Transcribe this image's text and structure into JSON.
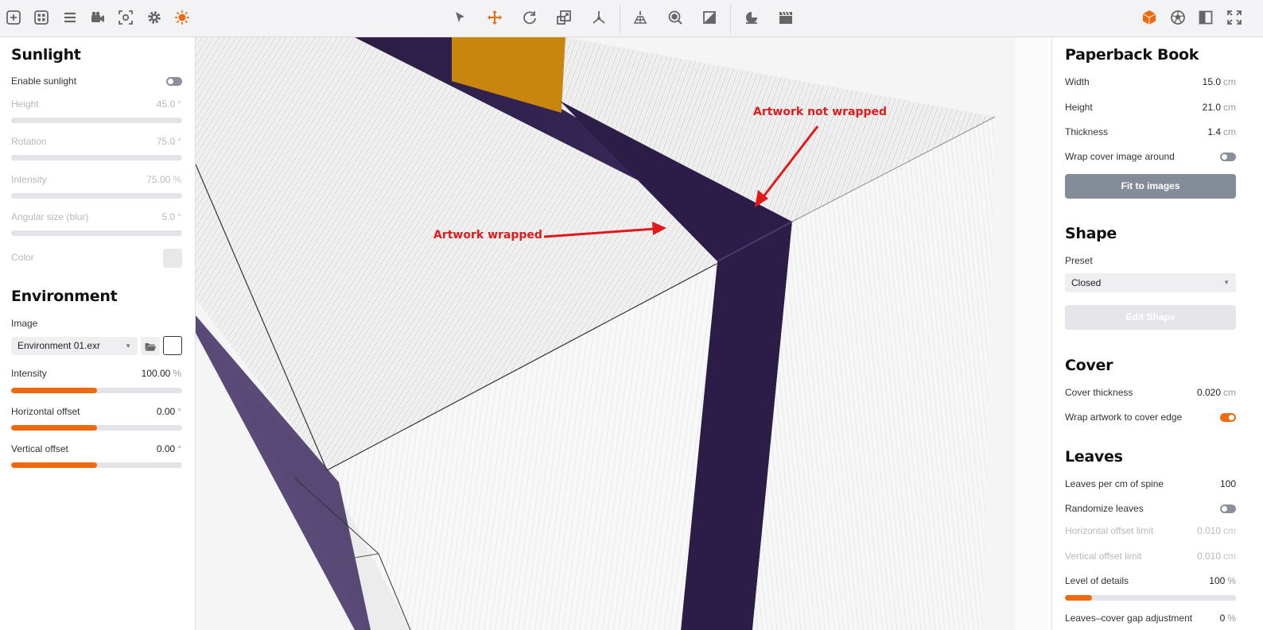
{
  "toolbar": {
    "left_icons": [
      "add-icon",
      "grid-icon",
      "list-icon",
      "camera-icon",
      "focus-icon",
      "gear-icon",
      "sun-icon"
    ],
    "center_icons": [
      "select-arrow-icon",
      "move-icon",
      "rotate-icon",
      "scale-icon",
      "axes-icon",
      "ground-grid-icon",
      "orbit-icon",
      "material-icon",
      "time-icon",
      "clapperboard-icon"
    ],
    "right_icons": [
      "cube-icon",
      "ball-icon",
      "layout-icon",
      "expand-icon"
    ],
    "accent": "#ee6a10"
  },
  "sunlight": {
    "title": "Sunlight",
    "enable_label": "Enable sunlight",
    "enable_on": false,
    "height_label": "Height",
    "height_value": "45.0",
    "height_unit": "°",
    "rotation_label": "Rotation",
    "rotation_value": "75.0",
    "rotation_unit": "°",
    "intensity_label": "Intensity",
    "intensity_value": "75.00",
    "intensity_unit": "%",
    "angular_label": "Angular size (blur)",
    "angular_value": "5.0",
    "angular_unit": "°",
    "color_label": "Color"
  },
  "environment": {
    "title": "Environment",
    "image_label": "Image",
    "image_value": "Environment 01.exr",
    "intensity_label": "Intensity",
    "intensity_value": "100.00",
    "intensity_unit": "%",
    "intensity_fraction": 0.5,
    "hoffset_label": "Horizontal offset",
    "hoffset_value": "0.00",
    "hoffset_unit": "°",
    "hoffset_fraction": 0.5,
    "voffset_label": "Vertical offset",
    "voffset_value": "0.00",
    "voffset_unit": "°",
    "voffset_fraction": 0.5
  },
  "book": {
    "title": "Paperback Book",
    "width_label": "Width",
    "width_value": "15.0",
    "width_unit": "cm",
    "height_label": "Height",
    "height_value": "21.0",
    "height_unit": "cm",
    "thickness_label": "Thickness",
    "thickness_value": "1.4",
    "thickness_unit": "cm",
    "wrap_label": "Wrap cover image around",
    "wrap_on": false,
    "fit_button": "Fit to images"
  },
  "shape": {
    "title": "Shape",
    "preset_label": "Preset",
    "preset_value": "Closed",
    "edit_button": "Edit Shape"
  },
  "cover": {
    "title": "Cover",
    "thickness_label": "Cover thickness",
    "thickness_value": "0.020",
    "thickness_unit": "cm",
    "wrap_label": "Wrap artwork to cover edge",
    "wrap_on": true
  },
  "leaves": {
    "title": "Leaves",
    "per_cm_label": "Leaves per cm of spine",
    "per_cm_value": "100",
    "randomize_label": "Randomize leaves",
    "randomize_on": false,
    "hlimit_label": "Horizontal offset limit",
    "hlimit_value": "0.010",
    "hlimit_unit": "cm",
    "vlimit_label": "Vertical offset limit",
    "vlimit_value": "0.010",
    "vlimit_unit": "cm",
    "lod_label": "Level of details",
    "lod_value": "100",
    "lod_unit": "%",
    "lod_fraction": 0.16,
    "gap_label": "Leaves–cover gap adjustment",
    "gap_value": "0",
    "gap_unit": "%"
  },
  "annotations": {
    "not_wrapped": "Artwork not wrapped",
    "wrapped": "Artwork wrapped"
  }
}
